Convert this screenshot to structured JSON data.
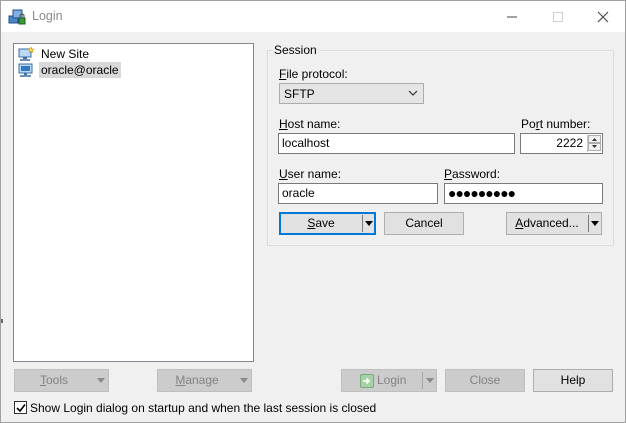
{
  "window": {
    "title": "Login"
  },
  "tree": {
    "items": [
      {
        "label": "New Site",
        "icon": "new-site-icon"
      },
      {
        "label": "oracle@oracle",
        "icon": "computer-icon",
        "selected": true
      }
    ]
  },
  "session": {
    "legend": "Session",
    "file_protocol": {
      "label_pre": "",
      "label_ul": "F",
      "label_post": "ile protocol:",
      "value": "SFTP"
    },
    "host_name": {
      "label_pre": "",
      "label_ul": "H",
      "label_post": "ost name:",
      "value": "localhost"
    },
    "port_number": {
      "label_pre": "Po",
      "label_ul": "r",
      "label_post": "t number:",
      "value": "2222"
    },
    "user_name": {
      "label_pre": "",
      "label_ul": "U",
      "label_post": "ser name:",
      "value": "oracle"
    },
    "password": {
      "label_pre": "",
      "label_ul": "P",
      "label_post": "assword:",
      "value": "●●●●●●●●●"
    },
    "save": {
      "pre": "",
      "ul": "S",
      "post": "ave"
    },
    "cancel": "Cancel",
    "advanced": {
      "pre": "",
      "ul": "A",
      "post": "dvanced..."
    }
  },
  "bottom": {
    "tools": {
      "pre": "",
      "ul": "T",
      "post": "ools"
    },
    "manage": {
      "pre": "",
      "ul": "M",
      "post": "anage"
    },
    "login": "Login",
    "close": "Close",
    "help": "Help"
  },
  "startup_checkbox": {
    "label": "Show Login dialog on startup and when the last session is closed",
    "checked": true
  },
  "colors": {
    "accent": "#0078d7",
    "window_bg": "#f0f0f0",
    "button_bg": "#e1e1e1",
    "disabled_bg": "#cccccc"
  }
}
